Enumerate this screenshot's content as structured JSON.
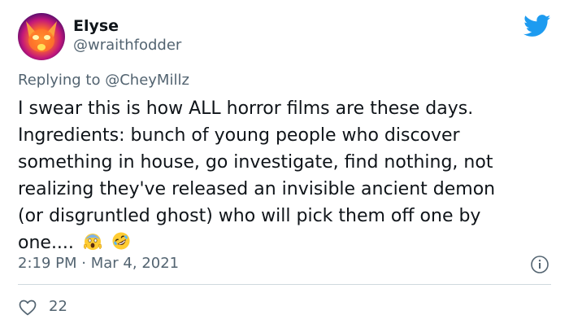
{
  "author": {
    "display_name": "Elyse",
    "handle": "@wraithfodder",
    "avatar_icon": "fox-face-avatar"
  },
  "brand": {
    "icon": "twitter-bird-icon",
    "color": "#1d9bf0"
  },
  "reply": {
    "prefix": "Replying to",
    "mention": "@CheyMillz"
  },
  "tweet": {
    "lines": [
      "I swear this is how ALL horror films are these days.",
      "Ingredients: bunch of young people who discover",
      "something in house, go investigate, find nothing, not",
      "realizing they've released an invisible ancient demon",
      "(or disgruntled ghost) who will pick them off one by",
      "one...."
    ],
    "emojis": [
      "screaming-face-emoji",
      "rolling-on-floor-laughing-emoji"
    ]
  },
  "meta": {
    "time": "2:19 PM",
    "separator": "·",
    "date": "Mar 4, 2021"
  },
  "actions": {
    "like_count": "22"
  },
  "colors": {
    "text": "#0f1419",
    "secondary": "#536471",
    "divider": "#cfd9de"
  }
}
